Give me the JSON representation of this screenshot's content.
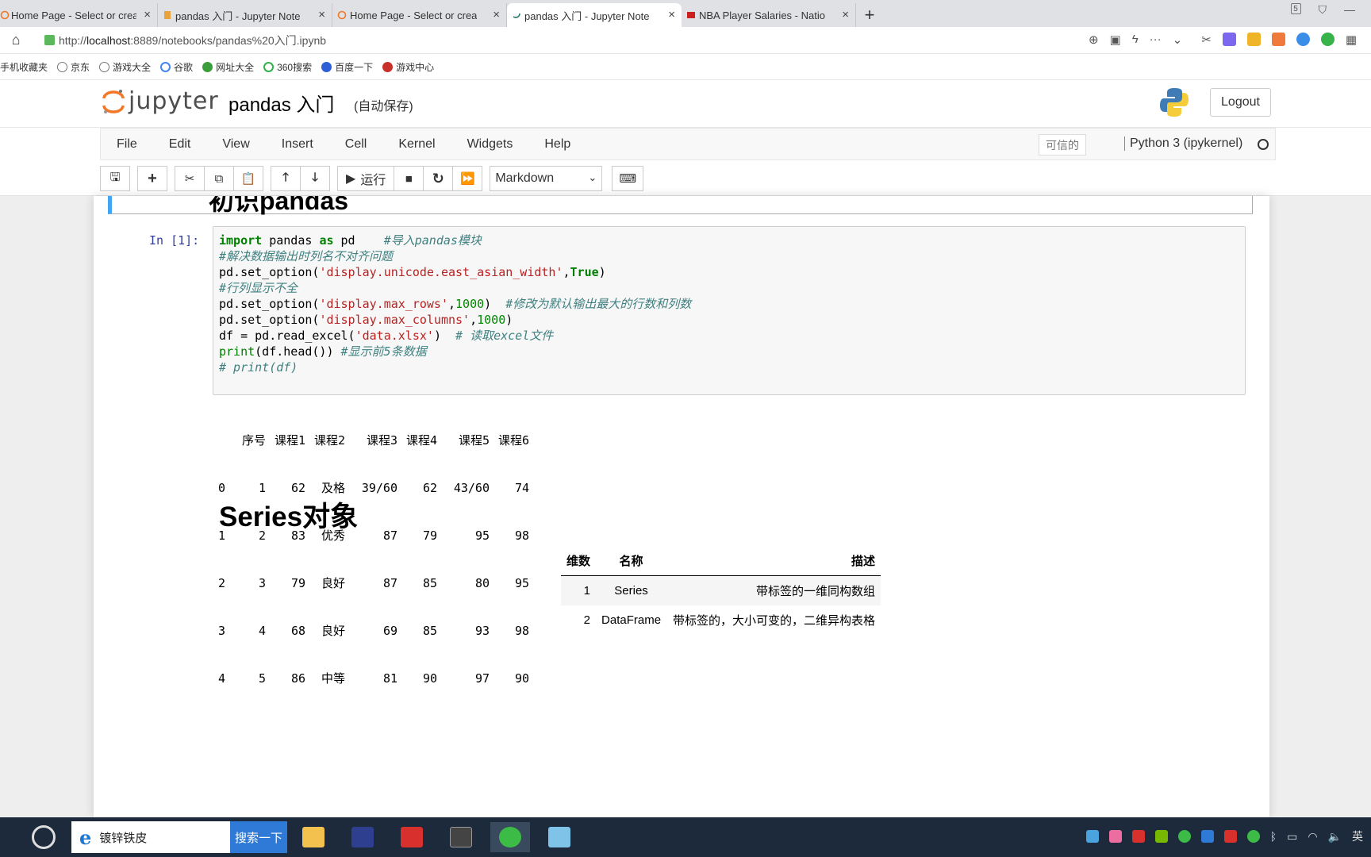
{
  "browser": {
    "tabs": [
      {
        "title": "Home Page - Select or crea",
        "icon": "jupyter-icon",
        "active": false
      },
      {
        "title": "pandas 入门 - Jupyter Note",
        "icon": "notebook-icon",
        "active": false
      },
      {
        "title": "Home Page - Select or crea",
        "icon": "jupyter-icon",
        "active": false
      },
      {
        "title": "pandas 入门 - Jupyter Note",
        "icon": "loading-icon",
        "active": true
      },
      {
        "title": "NBA Player Salaries - Natio",
        "icon": "espn-icon",
        "active": false
      }
    ],
    "new_tab": "+",
    "window_badge": "5",
    "url": {
      "prefix": "http://",
      "host": "localhost",
      "rest": ":8889/notebooks/pandas%20入门.ipynb"
    },
    "bookmarks": [
      "手机收藏夹",
      "京东",
      "游戏大全",
      "谷歌",
      "网址大全",
      "360搜索",
      "百度一下",
      "游戏中心"
    ]
  },
  "jupyter": {
    "logo_text": "jupyter",
    "notebook_title": "pandas 入门",
    "autosave": "(自动保存)",
    "logout": "Logout",
    "menu": [
      "File",
      "Edit",
      "View",
      "Insert",
      "Cell",
      "Kernel",
      "Widgets",
      "Help"
    ],
    "trusted": "可信的",
    "kernel": "Python 3 (ipykernel)",
    "toolbar": {
      "run_label": "运行",
      "cell_type": "Markdown"
    }
  },
  "notebook": {
    "top_heading_partial": "初识pandas",
    "prompt": "In  [1]:",
    "output": {
      "header": [
        "",
        "序号",
        "课程1",
        "课程2",
        "课程3",
        "课程4",
        "课程5",
        "课程6"
      ],
      "rows": [
        [
          "0",
          "1",
          "62",
          "及格",
          "39/60",
          "62",
          "43/60",
          "74"
        ],
        [
          "1",
          "2",
          "83",
          "优秀",
          "87",
          "79",
          "95",
          "98"
        ],
        [
          "2",
          "3",
          "79",
          "良好",
          "87",
          "85",
          "80",
          "95"
        ],
        [
          "3",
          "4",
          "68",
          "良好",
          "69",
          "85",
          "93",
          "98"
        ],
        [
          "4",
          "5",
          "86",
          "中等",
          "81",
          "90",
          "97",
          "90"
        ]
      ]
    },
    "series_heading": "Series对象",
    "table": {
      "headers": [
        "维数",
        "名称",
        "描述"
      ],
      "rows": [
        [
          "1",
          "Series",
          "带标签的一维同构数组"
        ],
        [
          "2",
          "DataFrame",
          "带标签的，大小可变的，二维异构表格"
        ]
      ]
    }
  },
  "taskbar": {
    "search_text": "镀锌铁皮",
    "search_button": "搜索一下",
    "lang": "英"
  }
}
